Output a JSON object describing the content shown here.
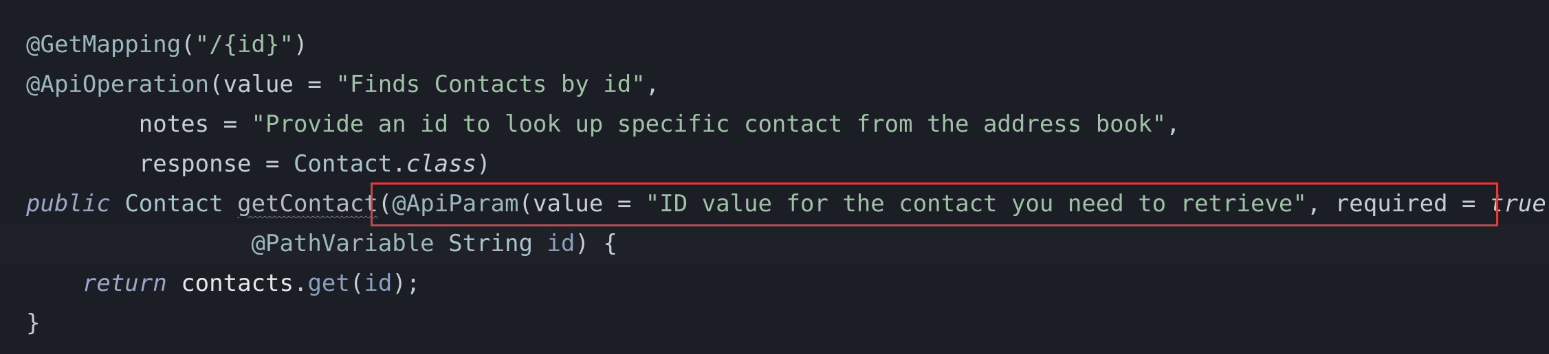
{
  "code": {
    "l1": {
      "annotation": "@GetMapping",
      "open": "(",
      "string": "\"/{id}\"",
      "close": ")"
    },
    "l2": {
      "annotation": "@ApiOperation",
      "open": "(",
      "key": "value = ",
      "string": "\"Finds Contacts by id\"",
      "comma": ","
    },
    "l3": {
      "indent": "        ",
      "key": "notes = ",
      "string": "\"Provide an id to look up specific contact from the address book\"",
      "comma": ","
    },
    "l4": {
      "indent": "        ",
      "key": "response = ",
      "type": "Contact",
      "dot": ".",
      "class_kw": "class",
      "close": ")"
    },
    "l5": {
      "kw": "public",
      "space1": " ",
      "type": "Contact",
      "space2": " ",
      "method": "getContact",
      "open": "(",
      "annotation": "@ApiParam",
      "open2": "(",
      "key": "value = ",
      "string": "\"ID value for the contact you need to retrieve\"",
      "mid": ", required = ",
      "bool": "true",
      "close": ")"
    },
    "l6": {
      "indent": "                ",
      "annotation": "@PathVariable",
      "space": " ",
      "type": "String",
      "space2": " ",
      "param": "id",
      "close": ") {"
    },
    "l7": {
      "indent": "    ",
      "kw": "return",
      "space": " ",
      "ident": "contacts",
      "dot": ".",
      "fn": "get",
      "args": "(",
      "param": "id",
      "end": ");"
    },
    "l8": {
      "brace": "}"
    }
  },
  "highlight": {
    "color": "#e03c3c"
  }
}
